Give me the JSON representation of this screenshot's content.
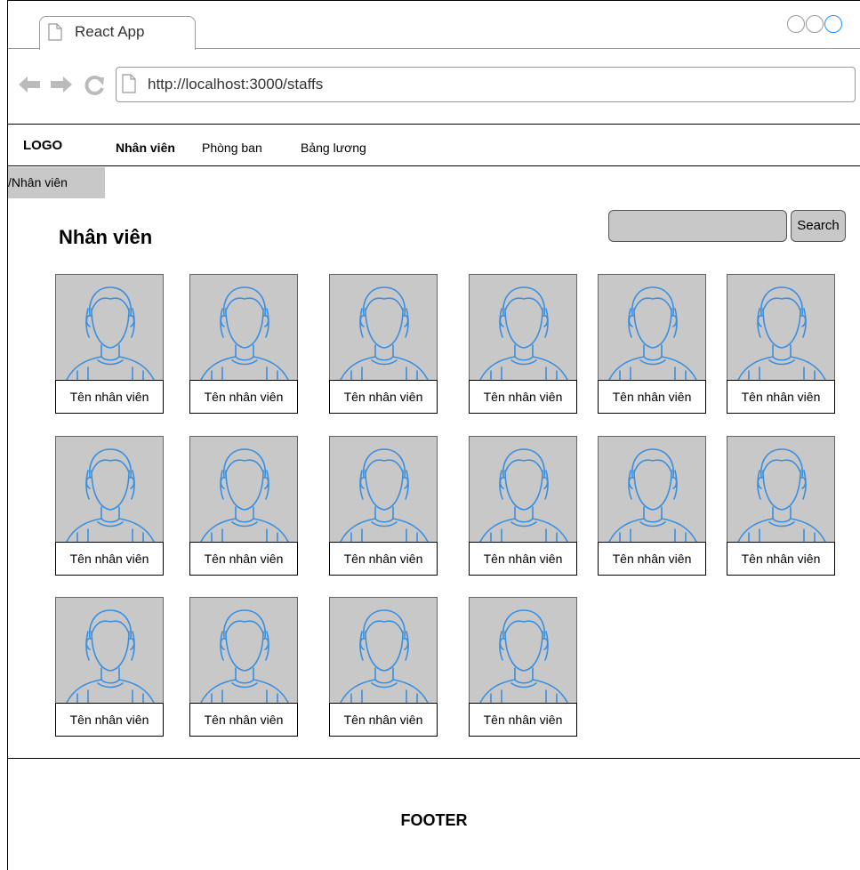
{
  "browser": {
    "tab_title": "React App",
    "url": "http://localhost:3000/staffs"
  },
  "navbar": {
    "logo": "LOGO",
    "items": [
      {
        "label": "Nhân viên",
        "active": true
      },
      {
        "label": "Phòng ban",
        "active": false
      },
      {
        "label": "Bảng lương",
        "active": false
      }
    ]
  },
  "breadcrumb": "/Nhân viên",
  "page": {
    "title": "Nhân viên",
    "search_label": "Search",
    "search_value": ""
  },
  "staff": [
    {
      "name": "Tên nhân viên"
    },
    {
      "name": "Tên nhân viên"
    },
    {
      "name": "Tên nhân viên"
    },
    {
      "name": "Tên nhân viên"
    },
    {
      "name": "Tên nhân viên"
    },
    {
      "name": "Tên nhân viên"
    },
    {
      "name": "Tên nhân viên"
    },
    {
      "name": "Tên nhân viên"
    },
    {
      "name": "Tên nhân viên"
    },
    {
      "name": "Tên nhân viên"
    },
    {
      "name": "Tên nhân viên"
    },
    {
      "name": "Tên nhân viên"
    },
    {
      "name": "Tên nhân viên"
    },
    {
      "name": "Tên nhân viên"
    },
    {
      "name": "Tên nhân viên"
    },
    {
      "name": "Tên nhân viên"
    }
  ],
  "footer": "FOOTER",
  "colors": {
    "placeholder_gray": "#c8c8c8",
    "avatar_stroke": "#3a8fe0"
  }
}
